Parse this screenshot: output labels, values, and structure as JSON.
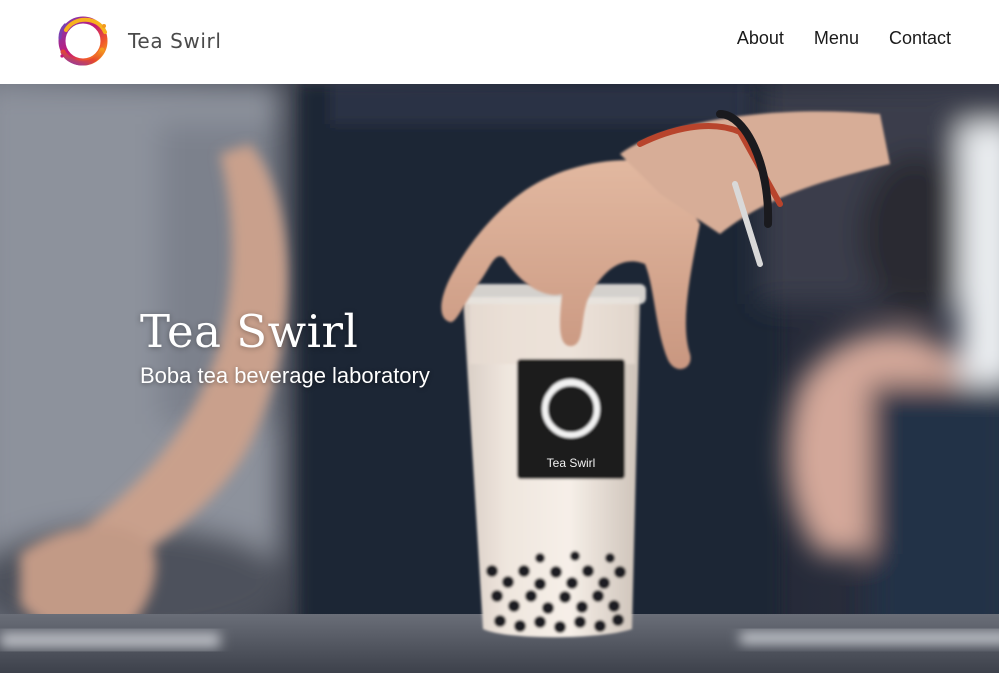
{
  "header": {
    "brand": {
      "name": "Tea Swirl",
      "logo_icon": "swirl-circle-logo-icon"
    },
    "nav": [
      {
        "label": "About"
      },
      {
        "label": "Menu"
      },
      {
        "label": "Contact"
      }
    ]
  },
  "hero": {
    "title": "Tea Swirl",
    "subtitle": "Boba tea beverage laboratory",
    "cup_label": "Tea Swirl",
    "image_subject": "hand-placing-boba-cup-photo"
  },
  "colors": {
    "header_bg": "#ffffff",
    "nav_text": "#1a1a1a",
    "brand_text": "#4a4a4a",
    "hero_text": "#ffffff",
    "logo_orange": "#f39a1e",
    "logo_magenta": "#c2187a",
    "logo_purple": "#7b3fb0"
  }
}
